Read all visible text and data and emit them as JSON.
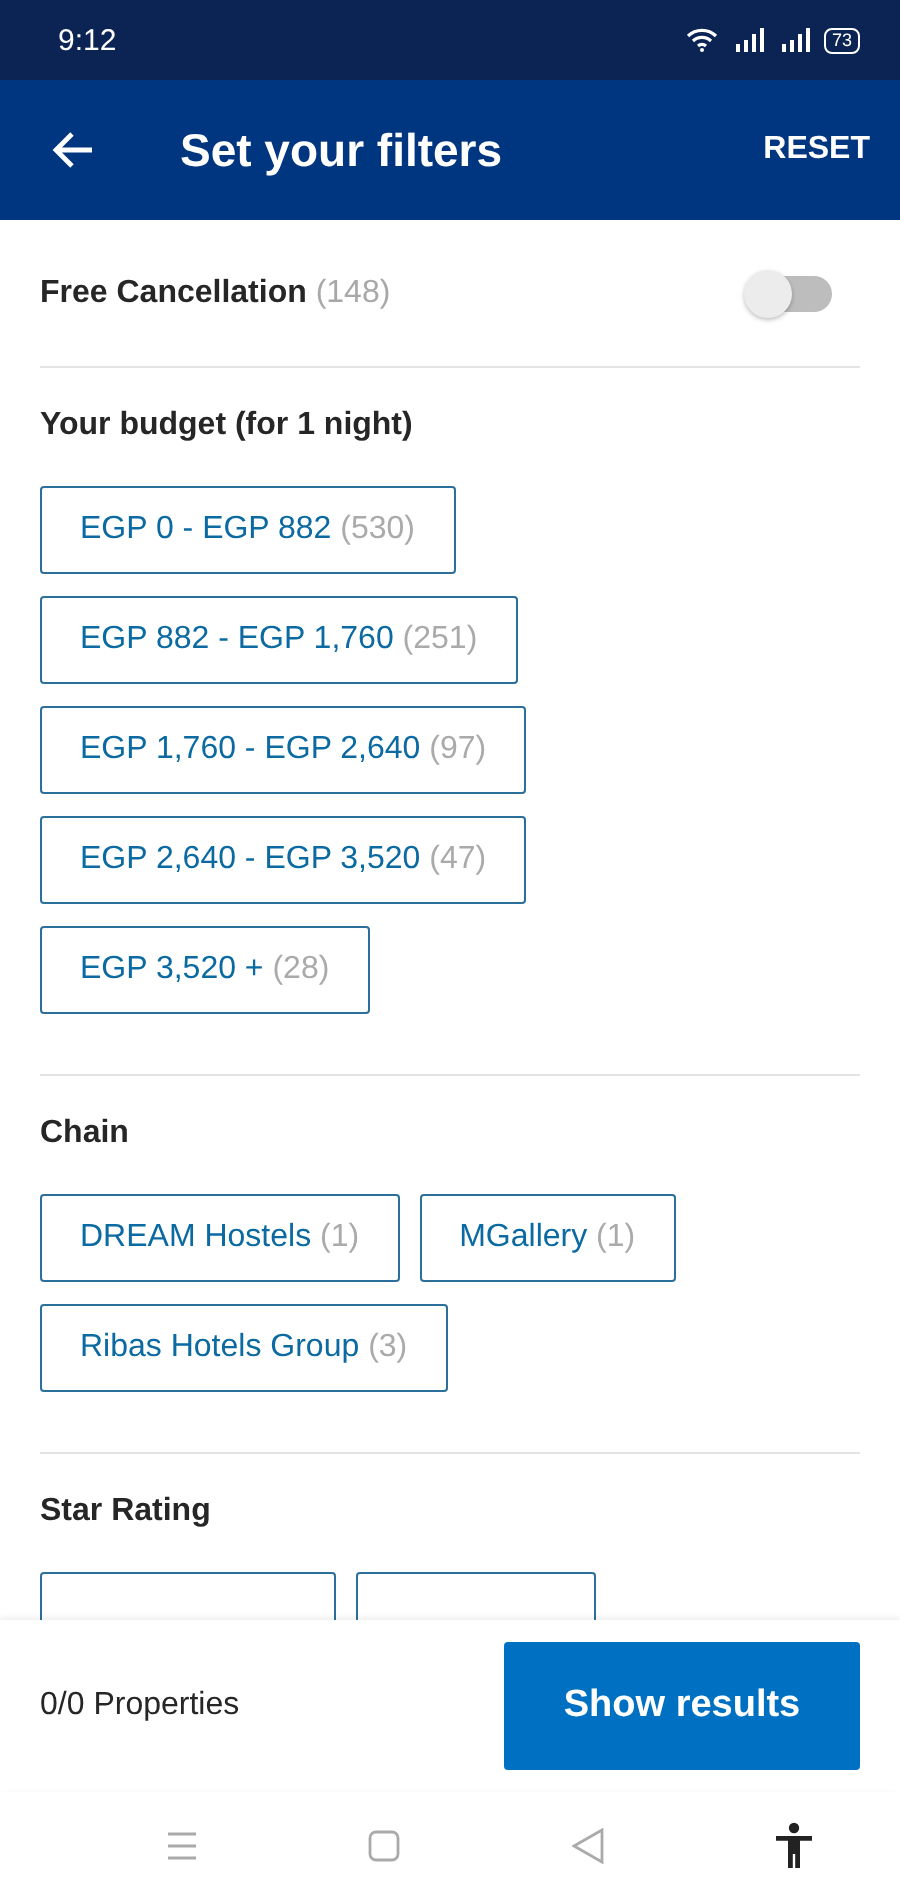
{
  "status_bar": {
    "time": "9:12",
    "battery": "73"
  },
  "header": {
    "title": "Set your filters",
    "reset": "RESET"
  },
  "free_cancellation": {
    "label": "Free Cancellation",
    "count": "(148)",
    "on": false
  },
  "sections": [
    {
      "title": "Your budget (for 1 night)",
      "options": [
        {
          "label": "EGP 0 - EGP 882",
          "count": "(530)",
          "selected": false
        },
        {
          "label": "EGP 882 - EGP 1,760",
          "count": "(251)",
          "selected": false
        },
        {
          "label": "EGP 1,760 - EGP 2,640",
          "count": "(97)",
          "selected": false
        },
        {
          "label": "EGP 2,640 - EGP 3,520",
          "count": "(47)",
          "selected": false
        },
        {
          "label": "EGP 3,520 +",
          "count": "(28)",
          "selected": false
        }
      ]
    },
    {
      "title": "Chain",
      "options": [
        {
          "label": "DREAM Hostels",
          "count": "(1)",
          "selected": false
        },
        {
          "label": "MGallery",
          "count": "(1)",
          "selected": false
        },
        {
          "label": "Ribas Hotels Group",
          "count": "(3)",
          "selected": false
        }
      ]
    },
    {
      "title": "Star Rating",
      "options": [
        {
          "kind": "hidden",
          "selected": false
        },
        {
          "kind": "hidden",
          "selected": false
        }
      ]
    }
  ],
  "footer": {
    "summary": "0/0 Properties",
    "button": "Show results"
  }
}
